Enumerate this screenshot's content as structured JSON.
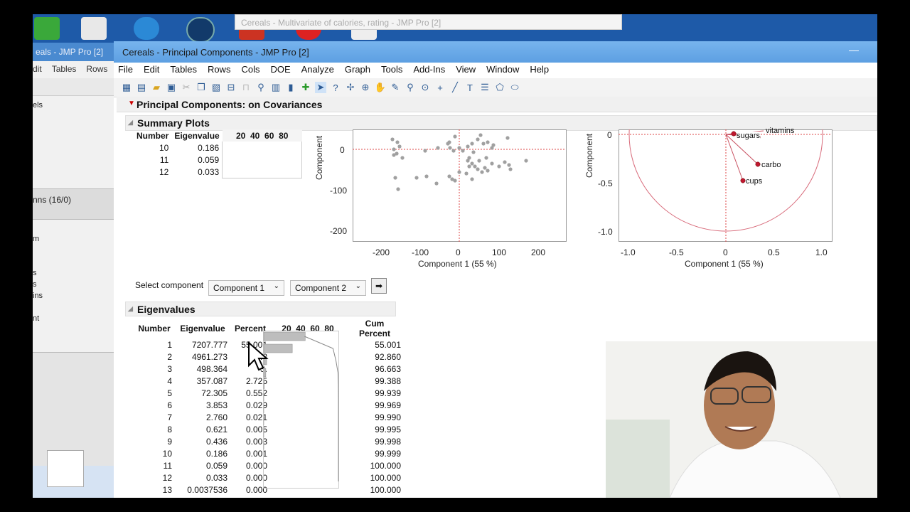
{
  "background_window": {
    "title": "eals - JMP Pro [2]",
    "menu": [
      "dit",
      "Tables",
      "Rows"
    ],
    "text_fragments": [
      "els",
      "nns (16/0)",
      "m",
      "s",
      "s",
      "ins",
      "nt"
    ]
  },
  "behind_window": {
    "title": "Cereals - Multivariate of calories, rating - JMP Pro [2]"
  },
  "window": {
    "title": "Cereals - Principal Components - JMP Pro [2]",
    "minimize": "—",
    "menu": [
      "File",
      "Edit",
      "Tables",
      "Rows",
      "Cols",
      "DOE",
      "Analyze",
      "Graph",
      "Tools",
      "Add-Ins",
      "View",
      "Window",
      "Help"
    ]
  },
  "report": {
    "title": "Principal Components: on Covariances",
    "summary_title": "Summary Plots",
    "summary_table": {
      "headers": [
        "Number",
        "Eigenvalue",
        "20",
        "40",
        "60",
        "80"
      ],
      "rows": [
        [
          "10",
          "0.186"
        ],
        [
          "11",
          "0.059"
        ],
        [
          "12",
          "0.033"
        ]
      ]
    },
    "score_plot": {
      "ylabel": "Component",
      "xlabel": "Component 1  (55 %)",
      "x_ticks": [
        "-200",
        "-100",
        "0",
        "100",
        "200"
      ],
      "y_ticks": [
        "0",
        "-100",
        "-200"
      ]
    },
    "loading_plot": {
      "ylabel": "Component",
      "xlabel": "Component 1  (55 %)",
      "x_ticks": [
        "-1.0",
        "-0.5",
        "0",
        "0.5",
        "1.0"
      ],
      "y_ticks": [
        "0",
        "-0.5",
        "-1.0"
      ],
      "labels": [
        "vitamins",
        "sugars",
        "carbo",
        "cups"
      ]
    },
    "select_label": "Select component",
    "component_x": "Component 1",
    "component_y": "Component 2",
    "eigen_title": "Eigenvalues",
    "eigen_headers": [
      "Number",
      "Eigenvalue",
      "Percent",
      "20",
      "40",
      "60",
      "80",
      "Cum Percent"
    ],
    "eigen_rows": [
      [
        "1",
        "7207.777",
        "55.001",
        "55.001"
      ],
      [
        "2",
        "4961.273",
        "37.8",
        "92.860"
      ],
      [
        "3",
        "498.364",
        "3.",
        "96.663"
      ],
      [
        "4",
        "357.087",
        "2.725",
        "99.388"
      ],
      [
        "5",
        "72.305",
        "0.552",
        "99.939"
      ],
      [
        "6",
        "3.853",
        "0.029",
        "99.969"
      ],
      [
        "7",
        "2.760",
        "0.021",
        "99.990"
      ],
      [
        "8",
        "0.621",
        "0.005",
        "99.995"
      ],
      [
        "9",
        "0.436",
        "0.003",
        "99.998"
      ],
      [
        "10",
        "0.186",
        "0.001",
        "99.999"
      ],
      [
        "11",
        "0.059",
        "0.000",
        "100.000"
      ],
      [
        "12",
        "0.033",
        "0.000",
        "100.000"
      ],
      [
        "13",
        "0.0037536",
        "0.000",
        "100.000"
      ]
    ],
    "percent_bars": [
      55.001,
      37.859,
      3.803,
      2.725,
      0.552,
      0.029,
      0.021,
      0.005,
      0.003,
      0.001,
      0,
      0,
      0
    ]
  },
  "icons": [
    "dropdown-triangle-icon",
    "arrow-pointer-icon",
    "help-icon",
    "crosshair-icon",
    "hand-icon",
    "brush-icon",
    "lasso-icon",
    "zoom-icon",
    "plus-icon",
    "line-icon",
    "text-icon",
    "ellipse-icon"
  ]
}
